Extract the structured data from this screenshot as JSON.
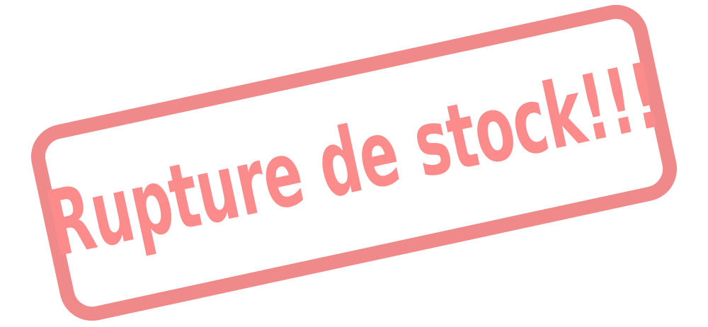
{
  "stamp": {
    "text": "Rupture de stock!!!",
    "border_color": "#f08a8a",
    "text_color": "#fc8c8c"
  }
}
